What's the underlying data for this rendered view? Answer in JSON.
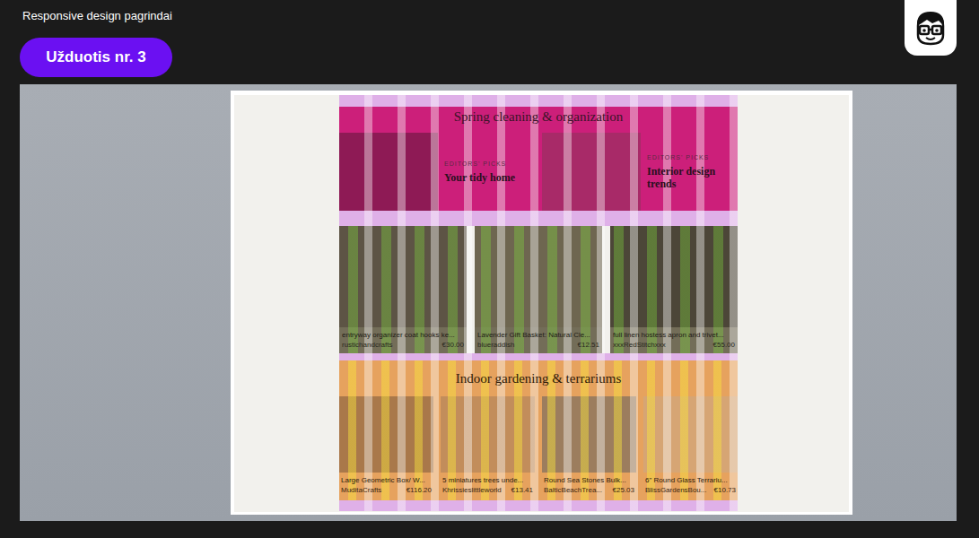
{
  "header": {
    "title": "Responsive design pagrindai"
  },
  "task_button": {
    "label": "Užduotis nr. 3"
  },
  "mockup": {
    "featured": {
      "title": "Spring cleaning & organization",
      "cards": [
        {
          "kicker": "EDITORS' PICKS",
          "title": "Your tidy home"
        },
        {
          "kicker": "EDITORS' PICKS",
          "title": "Interior design trends"
        }
      ]
    },
    "products": [
      {
        "title": "entryway organizer coat hooks ke...",
        "shop": "rustichandcrafts",
        "price": "€30.00"
      },
      {
        "title": "Lavender Gift Basket: Natural Cle...",
        "shop": "blueraddish",
        "price": "€12.51"
      },
      {
        "title": "full linen hostess apron and trivet...",
        "shop": "xxxRedStitchxxx",
        "price": "€55.00"
      }
    ],
    "gardening": {
      "title": "Indoor gardening & terrariums",
      "products": [
        {
          "title": "Large Geometric Box/ W...",
          "shop": "MuditaCrafts",
          "price": "€116.20"
        },
        {
          "title": "5 miniatures trees unde...",
          "shop": "Khrissieslittleworld",
          "price": "€13.41"
        },
        {
          "title": "Round Sea Stones Bulk...",
          "shop": "BalticBeachTrea...",
          "price": "€25.03"
        },
        {
          "title": "6\" Round Glass Terrariu...",
          "shop": "BlissGardensBou...",
          "price": "€10.73"
        }
      ]
    }
  }
}
